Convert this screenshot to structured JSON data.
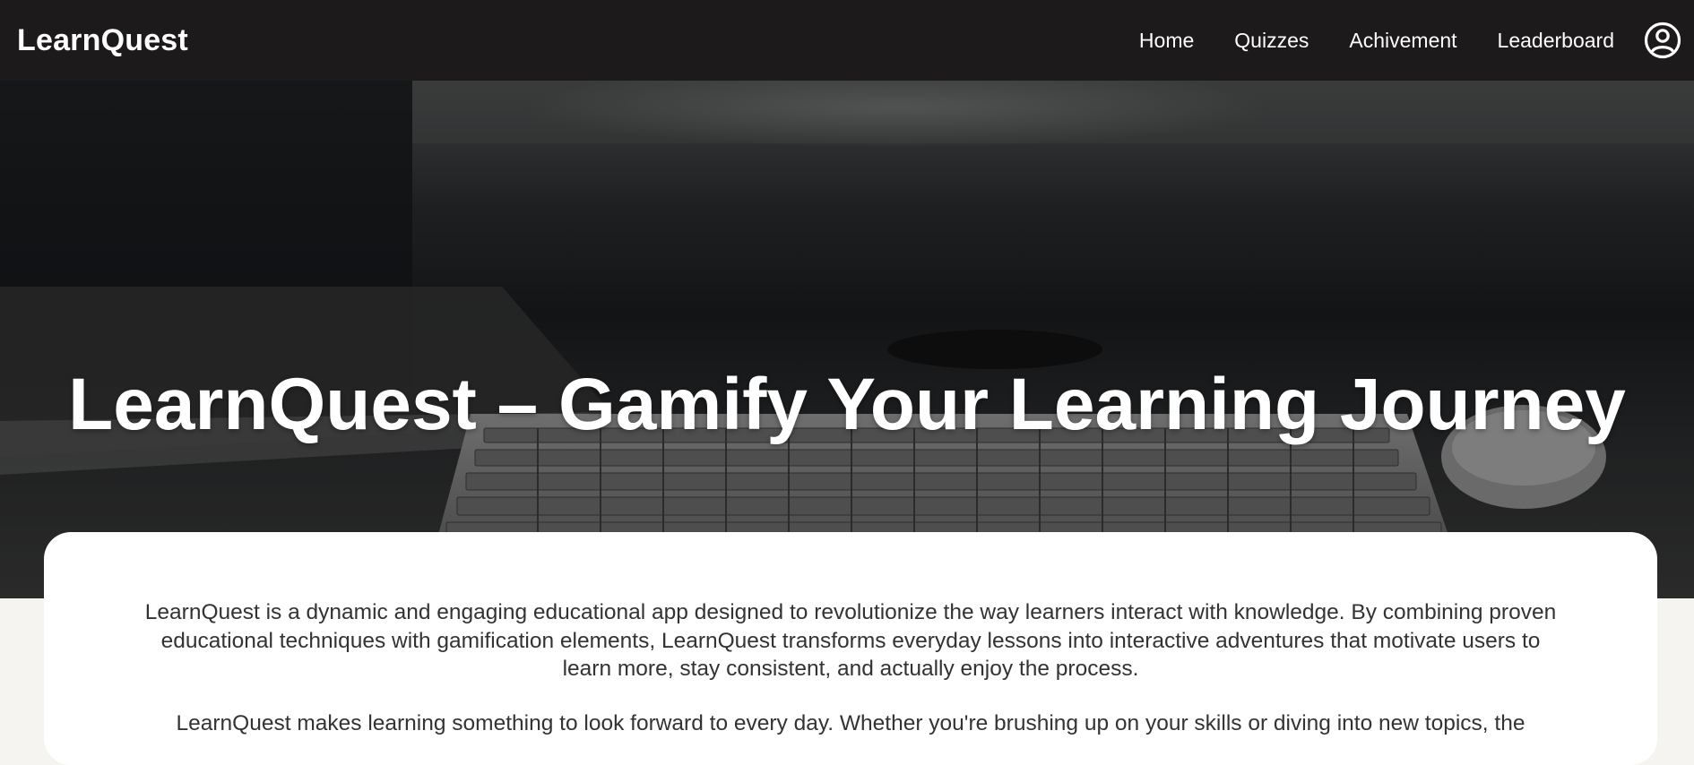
{
  "header": {
    "brand": "LearnQuest",
    "nav": [
      {
        "label": "Home"
      },
      {
        "label": "Quizzes"
      },
      {
        "label": "Achivement"
      },
      {
        "label": "Leaderboard"
      }
    ],
    "profile_icon": "user-circle-icon"
  },
  "hero": {
    "title": "LearnQuest – Gamify Your Learning Journey",
    "background": "dark-desk-keyboard-photo"
  },
  "about": {
    "paragraph1": "LearnQuest is a dynamic and engaging educational app designed to revolutionize the way learners interact with knowledge. By combining proven educational techniques with gamification elements, LearnQuest transforms everyday lessons into interactive adventures that motivate users to learn more, stay consistent, and actually enjoy the process.",
    "paragraph2": "LearnQuest makes learning something to look forward to every day. Whether you're brushing up on your skills or diving into new topics, the"
  },
  "colors": {
    "navbar_bg": "#1c1a1a",
    "page_bg": "#f5f4f1",
    "card_bg": "#ffffff",
    "body_text": "#333333"
  }
}
